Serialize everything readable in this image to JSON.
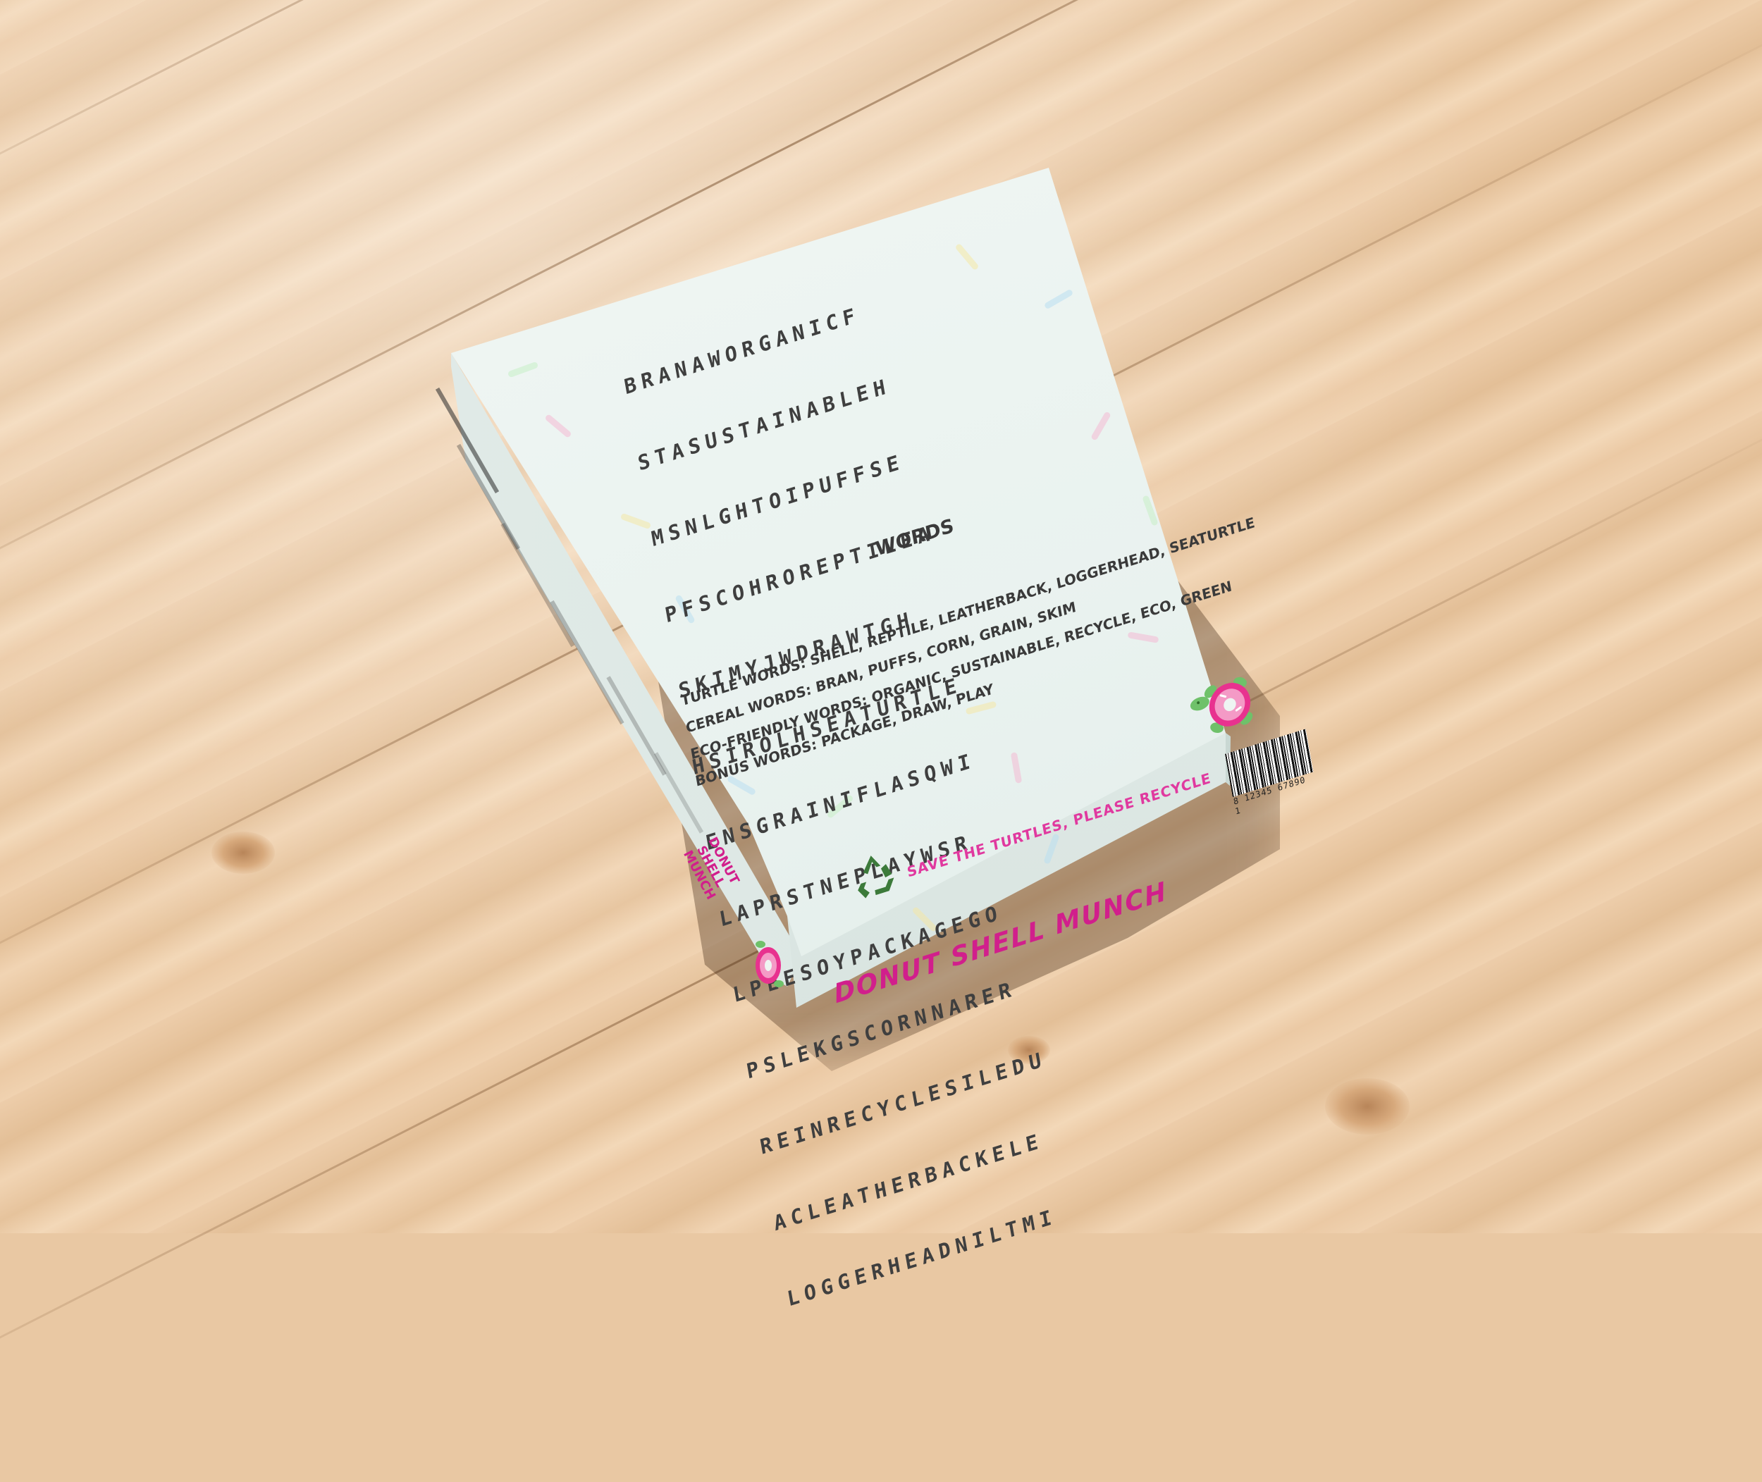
{
  "puzzle": {
    "rows": [
      "BRANAWORGANICF",
      "STASUSTAINABLEH",
      "MSNLGHTOIPUFFSE",
      "PFSCOHROREPTILEA",
      "SKIMYJWDRAWTGH",
      "HSIROLHSEATURTLE",
      "ENSGRAINIFLASQWI",
      "LAPRSTNEPLAYWSR",
      "LPEESOYPACKAGEGO",
      "PSLEKGSCORNNARER",
      "REINRECYCLESILEDU",
      "ACLEATHERBACKELE",
      "LOGGERHEADNILTMI"
    ],
    "words_title": "WORDS",
    "word_lists": [
      "TURTLE WORDS: SHELL, REPTILE, LEATHERBACK, LOGGERHEAD, SEATURTLE",
      "CEREAL WORDS: BRAN, PUFFS, CORN, GRAIN, SKIM",
      "ECO-FRIENDLY WORDS: ORGANIC, SUSTAINABLE, RECYCLE, ECO, GREEN",
      "BONUS WORDS: PACKAGE, DRAW, PLAY"
    ]
  },
  "barcode": {
    "number": "8 12345 67890 1"
  },
  "tagline": "SAVE THE TURTLES, PLEASE RECYCLE",
  "brand": {
    "name": "DONUT SHELL MUNCH",
    "side_name": "DONUT SHELL MUNCH"
  },
  "icons": [
    "recycle-icon",
    "turtle-donut-icon"
  ],
  "colors": {
    "brand_pink": "#d11f8c",
    "tagline_pink": "#e0399f",
    "recycle_green": "#3c7a3a",
    "box_mint": "#eef5f2",
    "wood": "#ebc9a4"
  }
}
